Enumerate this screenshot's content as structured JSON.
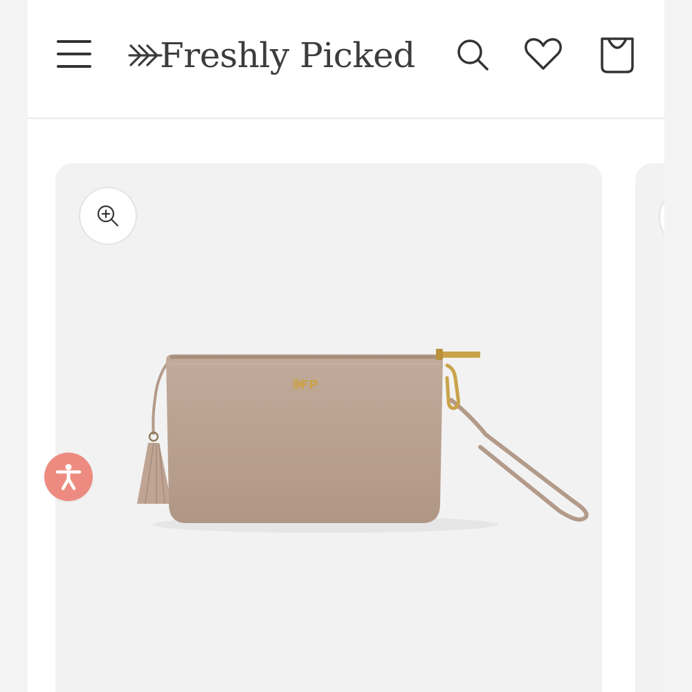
{
  "header": {
    "brand_name": "Freshly Picked",
    "icons": [
      "menu-icon",
      "search-icon",
      "heart-icon",
      "bag-icon"
    ]
  },
  "product": {
    "monogram": "FP",
    "colors": {
      "leather": "#b9a08f",
      "hardware": "#c9a24a"
    }
  },
  "accessibility": {
    "icon": "accessibility-icon",
    "color": "#ee8b80"
  }
}
